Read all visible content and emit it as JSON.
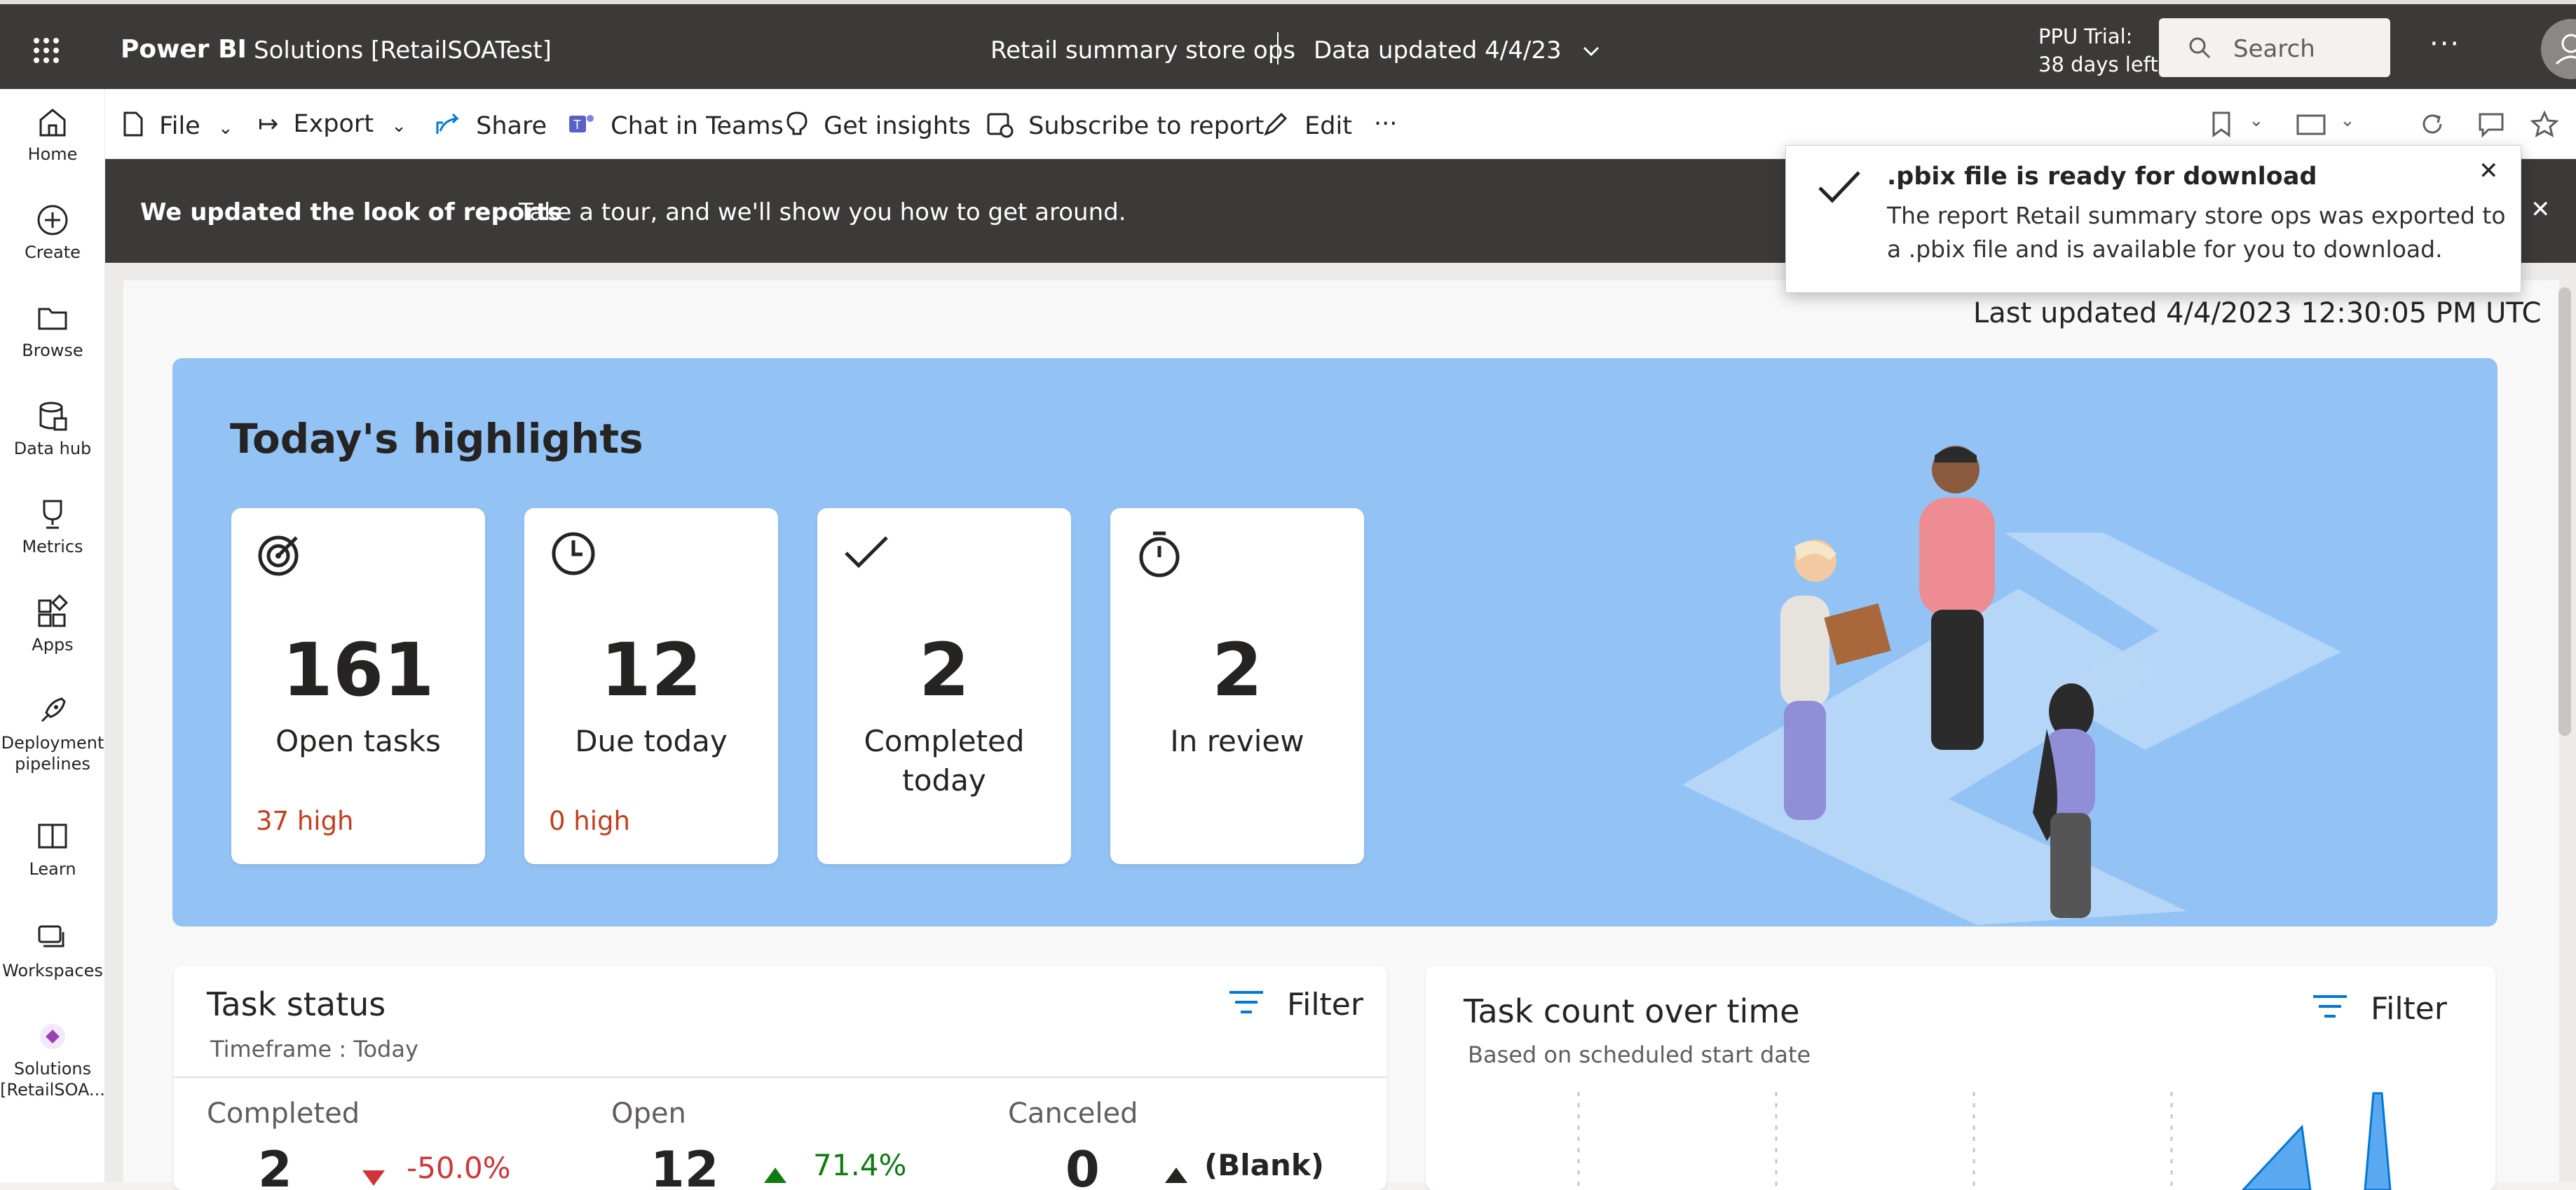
{
  "app": {
    "brand": "Power BI",
    "workspace": "Solutions [RetailSOATest]",
    "report_title": "Retail summary store ops",
    "data_updated": "Data updated 4/4/23",
    "trial_line1": "PPU Trial:",
    "trial_line2": "38 days left",
    "search_placeholder": "Search"
  },
  "nav": [
    {
      "label": "Home",
      "icon": "home-icon"
    },
    {
      "label": "Create",
      "icon": "plus-circle-icon"
    },
    {
      "label": "Browse",
      "icon": "folder-icon"
    },
    {
      "label": "Data hub",
      "icon": "database-icon"
    },
    {
      "label": "Metrics",
      "icon": "trophy-icon"
    },
    {
      "label": "Apps",
      "icon": "apps-icon"
    },
    {
      "label": "Deployment",
      "label2": "pipelines",
      "icon": "rocket-icon"
    },
    {
      "label": "Learn",
      "icon": "book-icon"
    },
    {
      "label": "Workspaces",
      "icon": "workspaces-icon"
    },
    {
      "label": "Solutions",
      "label2": "[RetailSOA...",
      "icon": "solutions-icon"
    }
  ],
  "toolbar": {
    "file": "File",
    "export": "Export",
    "share": "Share",
    "chat": "Chat in Teams",
    "insights": "Get insights",
    "subscribe": "Subscribe to report",
    "edit": "Edit",
    "more": "···"
  },
  "banner": {
    "bold": "We updated the look of reports",
    "text": "Take a tour, and we'll show you how to get around."
  },
  "toast": {
    "title": ".pbix file is ready for download",
    "line1": "The report Retail summary store ops was exported to",
    "line2": "a .pbix file and is available for you to download."
  },
  "report": {
    "last_updated": "Last updated 4/4/2023 12:30:05 PM UTC",
    "highlights_title": "Today's highlights",
    "cards": [
      {
        "value": "161",
        "label": "Open tasks",
        "label2": "",
        "sub": "37 high",
        "icon": "target-icon"
      },
      {
        "value": "12",
        "label": "Due today",
        "label2": "",
        "sub": "0 high",
        "icon": "clock-icon"
      },
      {
        "value": "2",
        "label": "Completed",
        "label2": "today",
        "sub": "",
        "icon": "checkmark-icon"
      },
      {
        "value": "2",
        "label": "In review",
        "label2": "",
        "sub": "",
        "icon": "stopwatch-icon"
      }
    ],
    "task_status": {
      "title": "Task status",
      "timeframe": "Timeframe : Today",
      "filter": "Filter",
      "completed_label": "Completed",
      "completed_value": "2",
      "completed_delta": "-50.0%",
      "open_label": "Open",
      "open_value": "12",
      "open_delta": "71.4%",
      "canceled_label": "Canceled",
      "canceled_value": "0",
      "canceled_delta": "(Blank)"
    },
    "task_count": {
      "title": "Task count over time",
      "subtitle": "Based on scheduled start date",
      "filter": "Filter"
    }
  },
  "colors": {
    "topbar": "#3b3a39",
    "hero": "#93c2f5",
    "negative": "#d13438",
    "positive": "#107c10",
    "accent": "#0078d4",
    "high": "#c43e1c"
  }
}
